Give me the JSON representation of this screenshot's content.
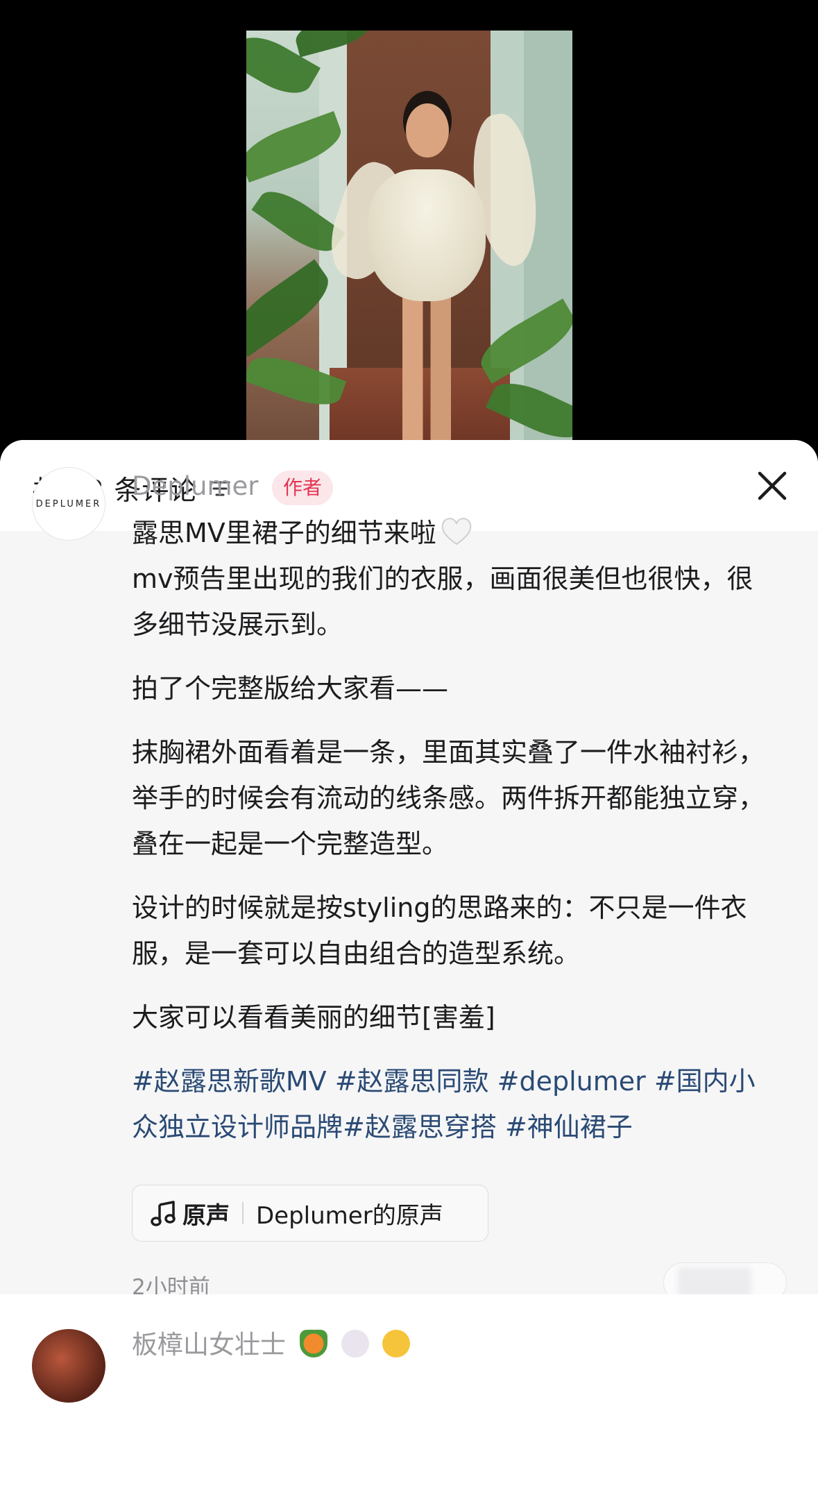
{
  "sheet": {
    "title": "共 72 条评论",
    "filter_icon": "filter-icon",
    "close_icon": "close-icon"
  },
  "author_comment": {
    "avatar_text": "DEPLUMER",
    "username": "Deplumer",
    "badge": "作者",
    "line1": "露思MV里裙子的细节来啦",
    "heart_icon": "white-heart-icon",
    "para1": "mv预告里出现的我们的衣服，画面很美但也很快，很多细节没展示到。",
    "para2": "拍了个完整版给大家看——",
    "para3": "抹胸裙外面看着是一条，里面其实叠了一件水袖衬衫，举手的时候会有流动的线条感。两件拆开都能独立穿，叠在一起是一个完整造型。",
    "para4": "设计的时候就是按styling的思路来的：不只是一件衣服，是一套可以自由组合的造型系统。",
    "para5": "大家可以看看美丽的细节[害羞]",
    "tags": "#赵露思新歌MV #赵露思同款 #deplumer #国内小众独立设计师品牌#赵露思穿搭 #神仙裙子",
    "sound_label": "原声",
    "sound_name": "Deplumer的原声",
    "timestamp": "2小时前"
  },
  "next_comment": {
    "username": "板樟山女壮士",
    "emojis": [
      "carrot-emoji",
      "rabbit-emoji",
      "cat-emoji"
    ]
  },
  "colors": {
    "sheet_bg": "#f6f6f7",
    "badge_text": "#e33553",
    "badge_bg": "#fbe6ea",
    "hashtag": "#2a4a74",
    "muted_text": "#8e8e93"
  }
}
